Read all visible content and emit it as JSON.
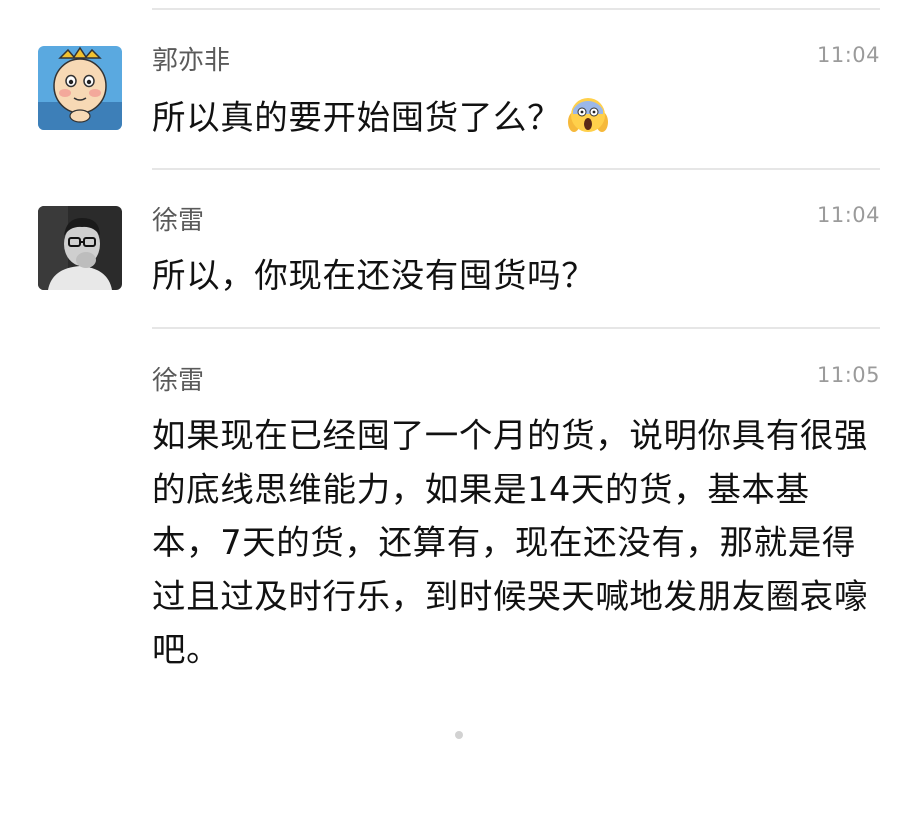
{
  "comments": [
    {
      "author": "郭亦非",
      "time": "11:04",
      "text": "所以真的要开始囤货了么？",
      "emoji": "scream-emoji",
      "avatar": "cartoon-king-avatar"
    },
    {
      "author": "徐雷",
      "time": "11:04",
      "text": "所以，你现在还没有囤货吗？",
      "avatar": "bw-photo-avatar"
    },
    {
      "author": "徐雷",
      "time": "11:05",
      "text": "如果现在已经囤了一个月的货，说明你具有很强的底线思维能力，如果是14天的货，基本基本，7天的货，还算有，现在还没有，那就是得过且过及时行乐，到时候哭天喊地发朋友圈哀嚎吧。"
    }
  ],
  "colors": {
    "name": "#5a5a5a",
    "time": "#9b9b9b",
    "text": "#111111",
    "divider": "#e6e6e6"
  }
}
